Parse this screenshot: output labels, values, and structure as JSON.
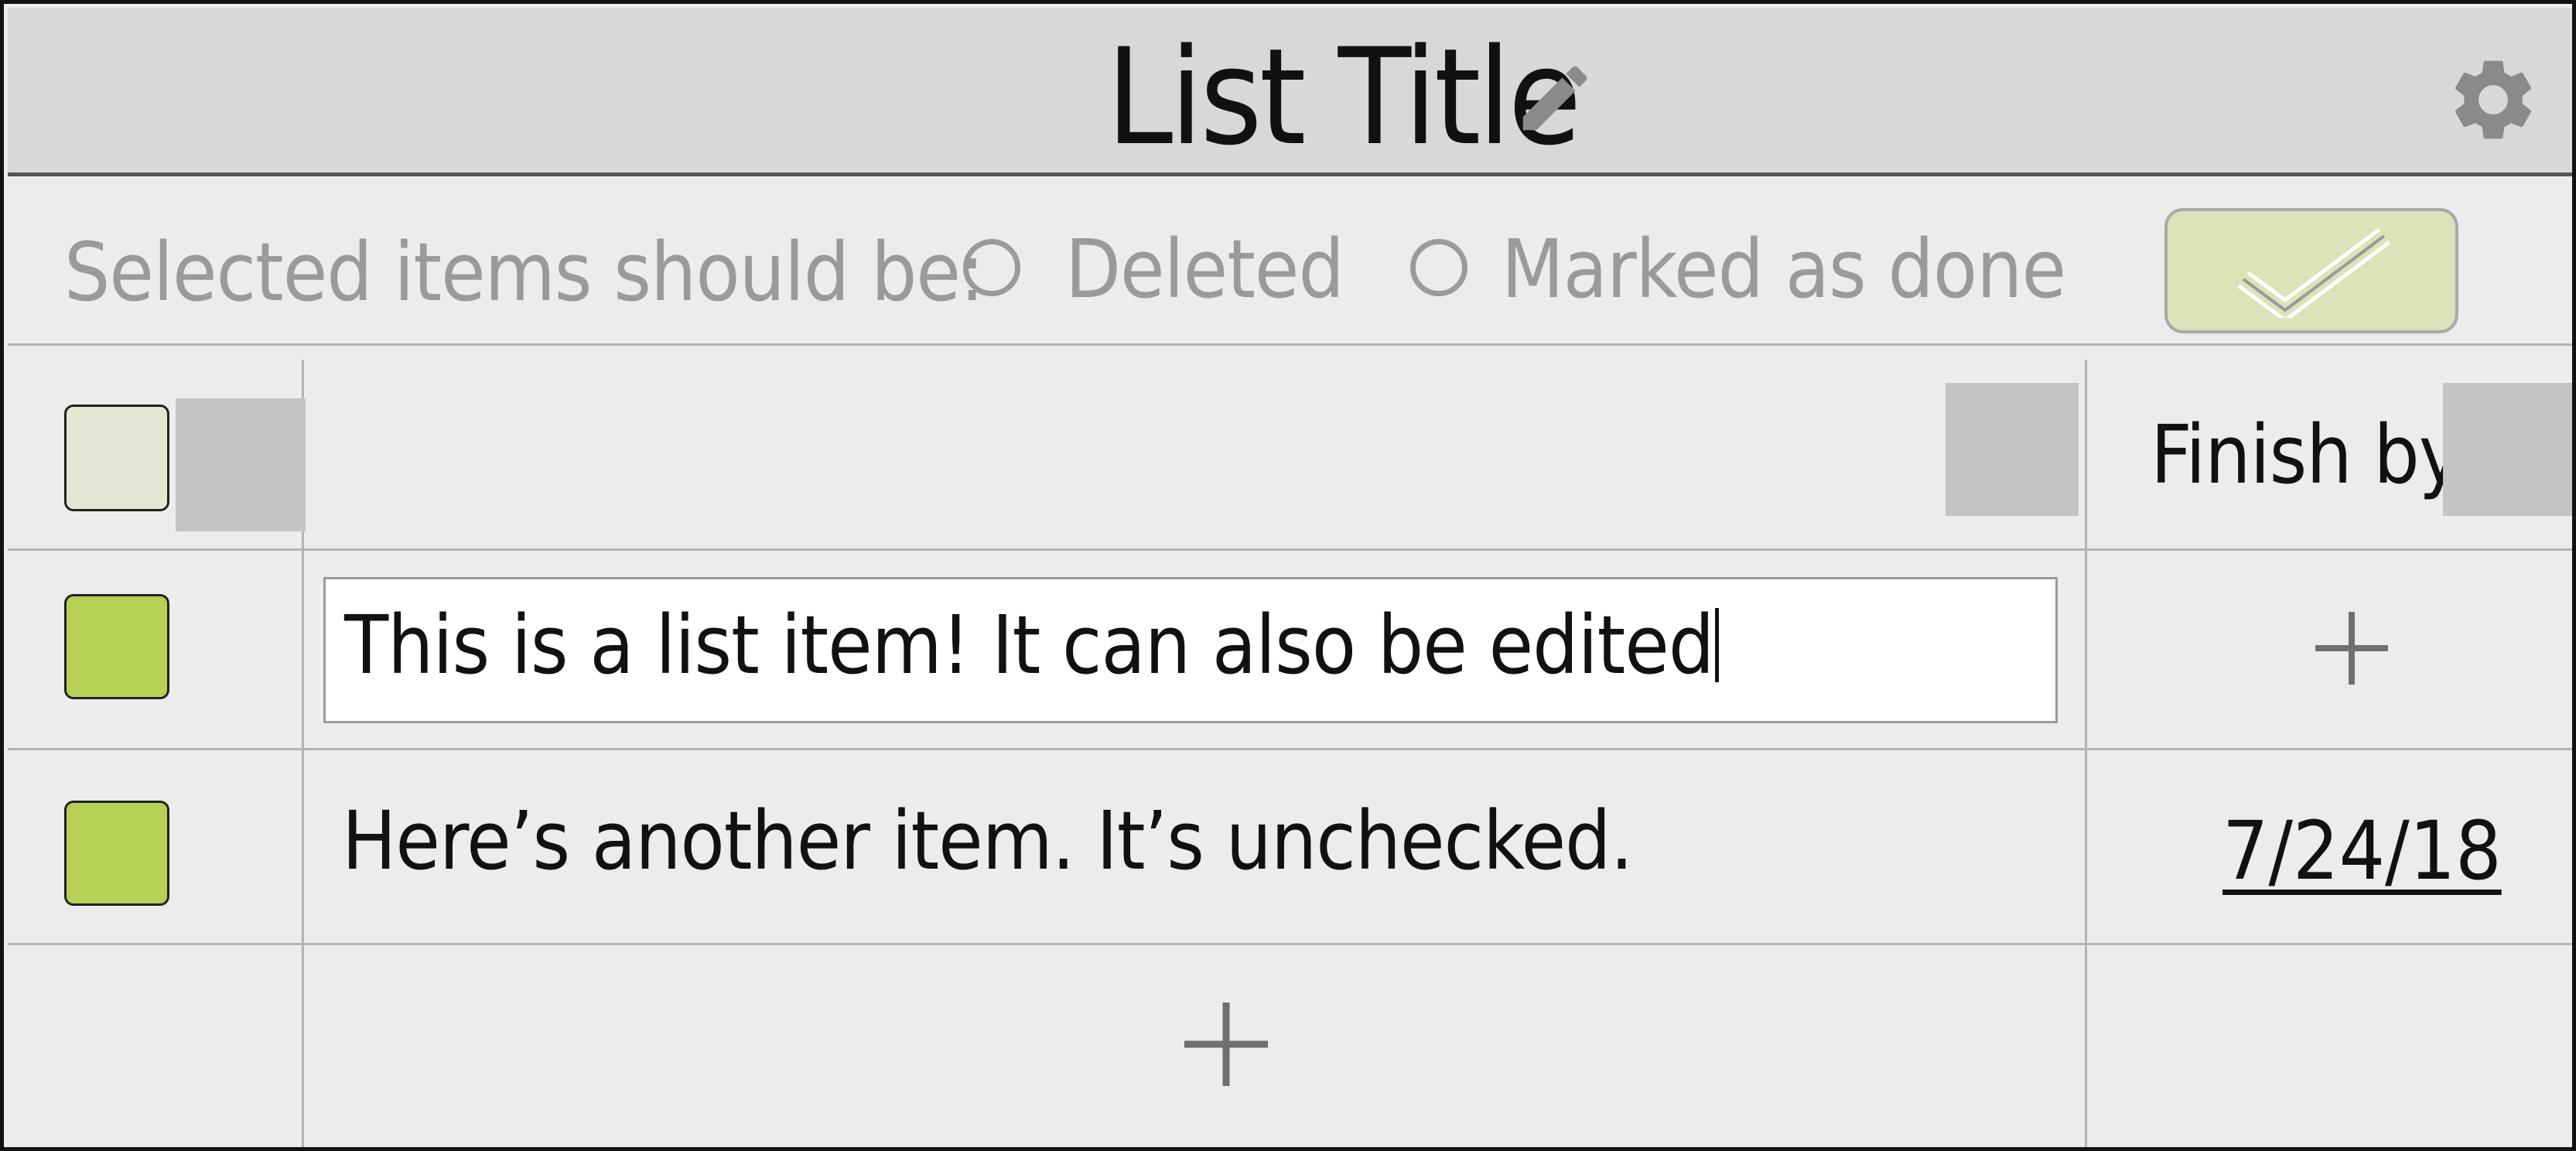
{
  "header": {
    "title": "List Title",
    "edit_icon": "pencil-icon",
    "settings_icon": "gear-icon"
  },
  "options": {
    "label": "Selected items should be:",
    "choices": [
      "Deleted",
      "Marked as done"
    ],
    "selected": null,
    "confirm_icon": "checkmark-icon"
  },
  "columns": {
    "finish_by_label": "Finish by:"
  },
  "items": [
    {
      "text": "This is a list item! It can also be edited",
      "checked": true,
      "editing": true,
      "finish_by": null,
      "finish_by_action_icon": "plus-icon"
    },
    {
      "text": "Here’s another item. It’s unchecked.",
      "checked": true,
      "editing": false,
      "finish_by": "7/24/18"
    }
  ],
  "add_item_icon": "plus-icon",
  "colors": {
    "header_bg": "#d8d8d8",
    "page_bg": "#ececec",
    "checkbox_green": "#b8d154",
    "confirm_bg": "#dbe3b8",
    "muted_text": "#9a9a9a"
  }
}
